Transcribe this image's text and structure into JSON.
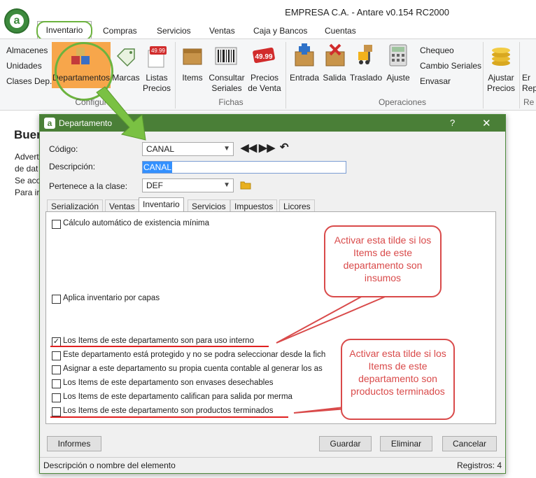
{
  "app": {
    "title": "EMPRESA C.A. - Antare v0.154 RC2000",
    "logo_letter": "a"
  },
  "menu_tabs": [
    "Inventario",
    "Compras",
    "Servicios",
    "Ventas",
    "Caja y Bancos",
    "Cuentas"
  ],
  "ribbon": {
    "config_links": [
      "Almacenes",
      "Unidades",
      "Clases Dep."
    ],
    "config_buttons": [
      "Departamentos",
      "Marcas",
      "Listas\nPrecios"
    ],
    "config_label": "Configur",
    "fichas_buttons": [
      "Items",
      "Consultar\nSeriales",
      "Precios\nde Venta"
    ],
    "fichas_label": "Fichas",
    "op_buttons": [
      "Entrada",
      "Salida",
      "Traslado",
      "Ajuste"
    ],
    "op_links": [
      "Chequeo",
      "Cambio Seriales",
      "Envasar"
    ],
    "op_label": "Operaciones",
    "extra_buttons": [
      "Ajustar\nPrecios",
      "Er\nRep"
    ],
    "extra_label": "Re",
    "price_tag": "49.99"
  },
  "background": {
    "heading": "Buer",
    "lines": [
      "Advert",
      "de dat",
      "Se aco",
      "Para ir"
    ]
  },
  "dialog": {
    "title": "Departamento",
    "help": "?",
    "close": "✕",
    "codigo_label": "Código:",
    "codigo_value": "CANAL",
    "descripcion_label": "Descripción:",
    "descripcion_value": "CANAL",
    "clase_label": "Pertenece a la clase:",
    "clase_value": "DEF",
    "tabs": [
      "Serialización",
      "Ventas",
      "Inventario",
      "Servicios",
      "Impuestos",
      "Licores"
    ],
    "active_tab": "Inventario",
    "checkboxes": [
      {
        "label": "Cálculo automático de existencia mínima",
        "checked": false
      },
      {
        "label": "Aplica inventario por capas",
        "checked": false
      },
      {
        "label": "Los Items de este departamento son para uso interno",
        "checked": true
      },
      {
        "label": "Este departamento está protegido y no se podra seleccionar desde la fich",
        "checked": false
      },
      {
        "label": "Asignar a este departamento su propia cuenta contable al generar los as",
        "checked": false
      },
      {
        "label": "Los Items de este departamento son envases desechables",
        "checked": false
      },
      {
        "label": "Los Items de este departamento califican para salida por merma",
        "checked": false
      },
      {
        "label": "Los Items de este departamento son productos terminados",
        "checked": false
      }
    ],
    "callouts": [
      "Activar esta tilde si los Items de este departamento son insumos",
      "Activar esta tilde si los Items de este departamento son productos terminados"
    ],
    "buttons": {
      "informes": "Informes",
      "guardar": "Guardar",
      "eliminar": "Eliminar",
      "cancelar": "Cancelar"
    },
    "status_text": "Descripción o nombre del elemento",
    "records": "Registros: 4"
  },
  "colors": {
    "accent_green": "#6cb33e",
    "dialog_title": "#4a7f37",
    "callout_red": "#d94a4a",
    "selected_button": "#f7a64b"
  }
}
